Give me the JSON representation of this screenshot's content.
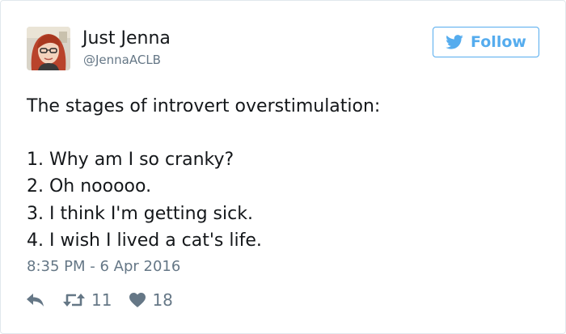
{
  "user": {
    "name": "Just Jenna",
    "handle": "@JennaACLB"
  },
  "follow_button": {
    "label": "Follow",
    "icon": "twitter-bird-icon"
  },
  "tweet": {
    "lines": [
      "The stages of introvert overstimulation:",
      "1. Why am I so cranky?",
      "2. Oh nooooo.",
      "3. I think I'm getting sick.",
      "4. I wish I lived a cat's life."
    ],
    "timestamp": "8:35 PM - 6 Apr 2016"
  },
  "actions": {
    "reply_icon": "reply-arrow-icon",
    "retweet_icon": "retweet-icon",
    "retweet_count": "11",
    "like_icon": "heart-icon",
    "like_count": "18"
  },
  "colors": {
    "accent": "#55acee",
    "text": "#14171a",
    "muted": "#657786",
    "border": "#e1e8ed"
  }
}
